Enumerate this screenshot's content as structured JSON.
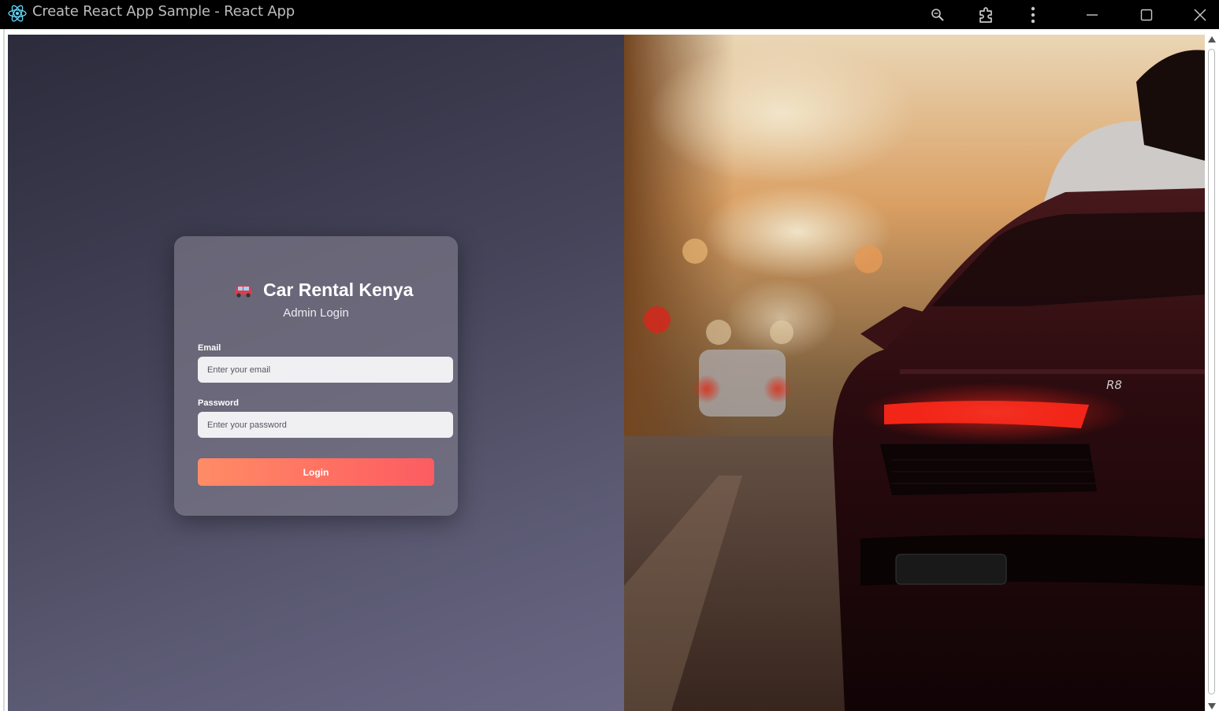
{
  "window": {
    "title": "Create React App Sample - React App",
    "app_icon": "react-logo-icon",
    "controls": [
      "zoom-icon",
      "extensions-icon",
      "more-vertical-icon",
      "minimize-icon",
      "maximize-icon",
      "close-icon"
    ]
  },
  "login": {
    "brand_icon": "car-icon",
    "title": "Car Rental Kenya",
    "subtitle": "Admin Login",
    "email_label": "Email",
    "email_placeholder": "Enter your email",
    "email_value": "",
    "password_label": "Password",
    "password_placeholder": "Enter your password",
    "password_value": "",
    "submit_label": "Login"
  },
  "hero_image": {
    "subject": "red sports car rear at sunset on city street",
    "badge_text": "R8"
  },
  "colors": {
    "button_gradient_start": "#ff8c66",
    "button_gradient_end": "#fb5c62",
    "panel_dark": "#2c2b3c",
    "panel_light": "#6a6784"
  }
}
